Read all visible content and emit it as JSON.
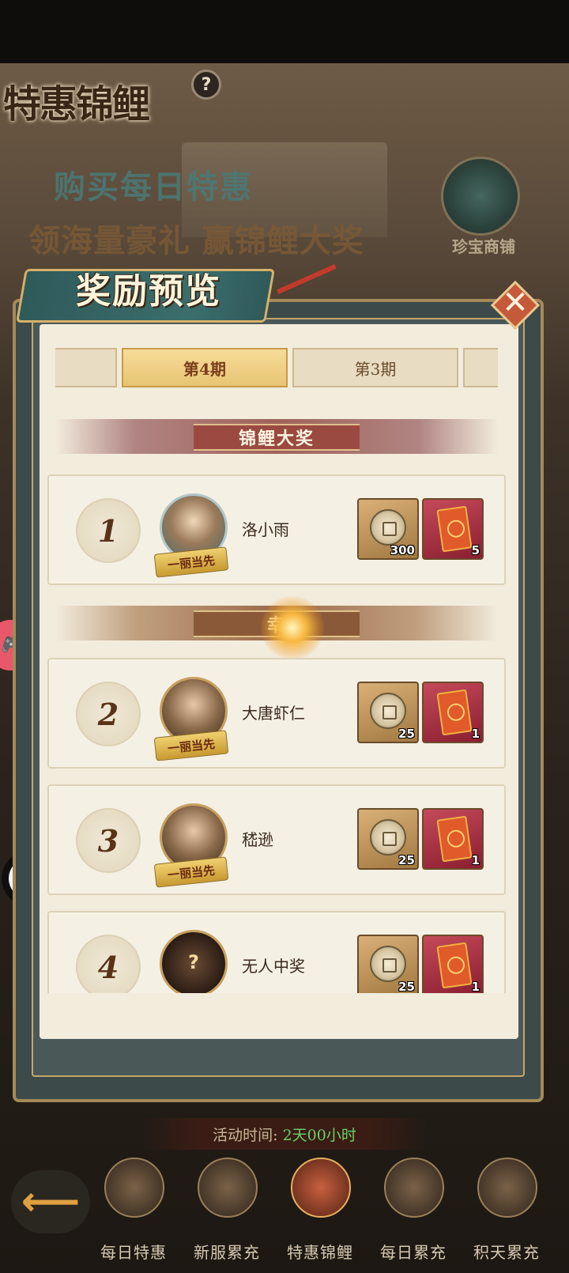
{
  "header": {
    "title": "特惠锦鲤",
    "promo_line1": "购买每日特惠",
    "promo_line2": "领海量豪礼 赢锦鲤大奖",
    "shop_label": "珍宝商铺"
  },
  "modal": {
    "title": "奖励预览",
    "close_glyph": "✕",
    "tabs": [
      "",
      "第4期",
      "第3期",
      ""
    ],
    "active_tab": "第4期",
    "section_grand": "锦鲤大奖",
    "section_lucky": "幸",
    "badge_text": "一丽当先",
    "rows": [
      {
        "rank": "1",
        "name": "洛小雨",
        "coin_qty": "300",
        "envelope_qty": "5"
      },
      {
        "rank": "2",
        "name": "大唐虾仁",
        "coin_qty": "25",
        "envelope_qty": "1"
      },
      {
        "rank": "3",
        "name": "嵇逊",
        "coin_qty": "25",
        "envelope_qty": "1"
      },
      {
        "rank": "4",
        "name": "无人中奖",
        "coin_qty": "25",
        "envelope_qty": "1",
        "avatar_glyph": "?"
      }
    ]
  },
  "activity": {
    "label": "活动时间:",
    "value": "2天00小时"
  },
  "bottom_nav": {
    "back_glyph": "⟵",
    "items": [
      "每日特惠",
      "新服累充",
      "特惠锦鲤",
      "每日累充",
      "积天累充"
    ],
    "active": "特惠锦鲤"
  },
  "side": {
    "game_glyph": "🎮",
    "chat_glyph": "•••"
  }
}
